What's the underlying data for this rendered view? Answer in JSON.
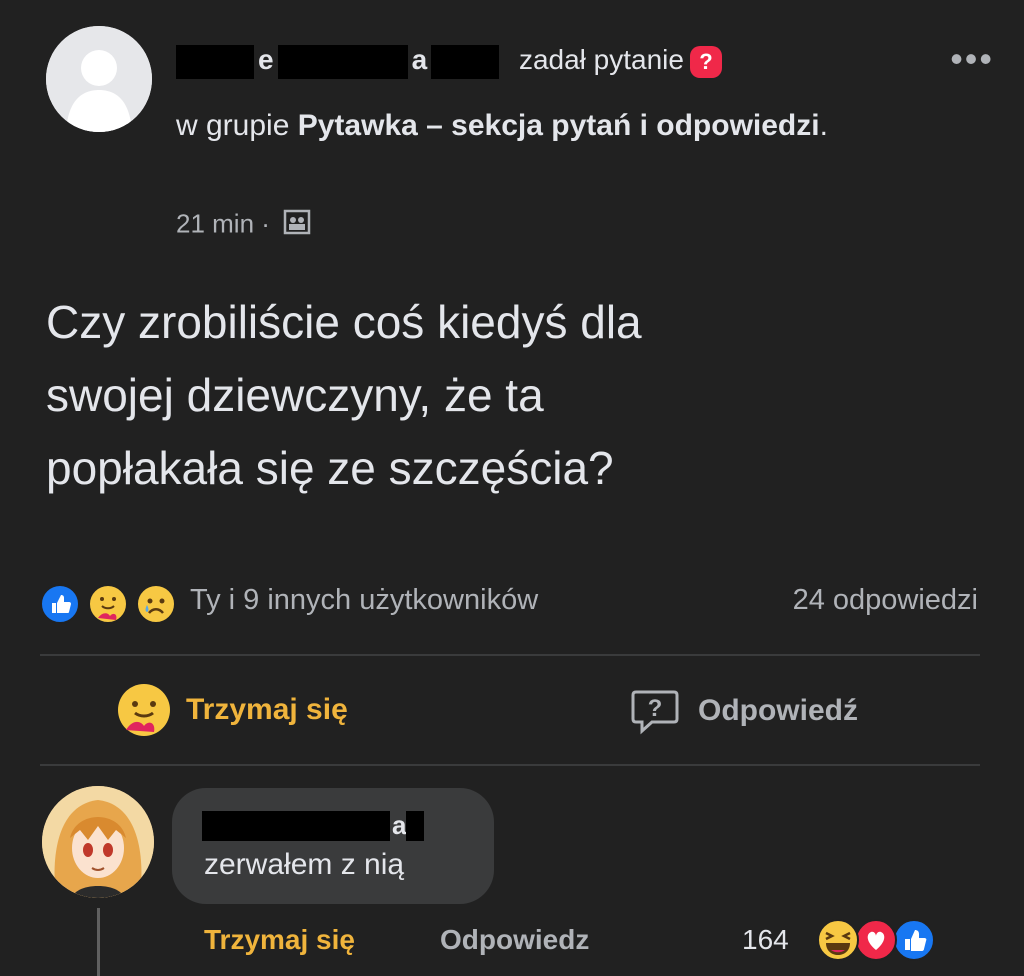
{
  "post": {
    "author_visible_letters": [
      "e",
      "a"
    ],
    "action": "zadał pytanie",
    "question_badge": "?",
    "in_group_prefix": "w grupie ",
    "group_name": "Pytawka – sekcja pytań i odpowiedzi",
    "group_suffix": ".",
    "time": "21 min",
    "separator": "·",
    "privacy_icon": "members-icon",
    "more_icon": "•••",
    "question_lines": [
      "Czy zrobiliście coś kiedyś dla",
      "swojej dziewczyny, że ta",
      "popłakała się ze szczęścia?"
    ]
  },
  "reactions": {
    "icons": [
      "like-icon",
      "care-icon",
      "sad-icon"
    ],
    "summary": "Ty i 9 innych użytkowników",
    "answers": "24 odpowiedzi"
  },
  "actions": {
    "hold": "Trzymaj się",
    "answer": "Odpowiedź"
  },
  "comment": {
    "author_visible_letter": "a",
    "text": "zerwałem z nią",
    "hold": "Trzymaj się",
    "reply": "Odpowiedz",
    "reaction_count": "164",
    "reaction_icons": [
      "haha-icon",
      "love-icon",
      "like-icon"
    ]
  },
  "colors": {
    "background": "#212121",
    "text": "#e4e6eb",
    "muted": "#b0b3b8",
    "care_gold": "#f0b43c",
    "like_blue": "#1877f2",
    "love_red": "#f02849"
  }
}
